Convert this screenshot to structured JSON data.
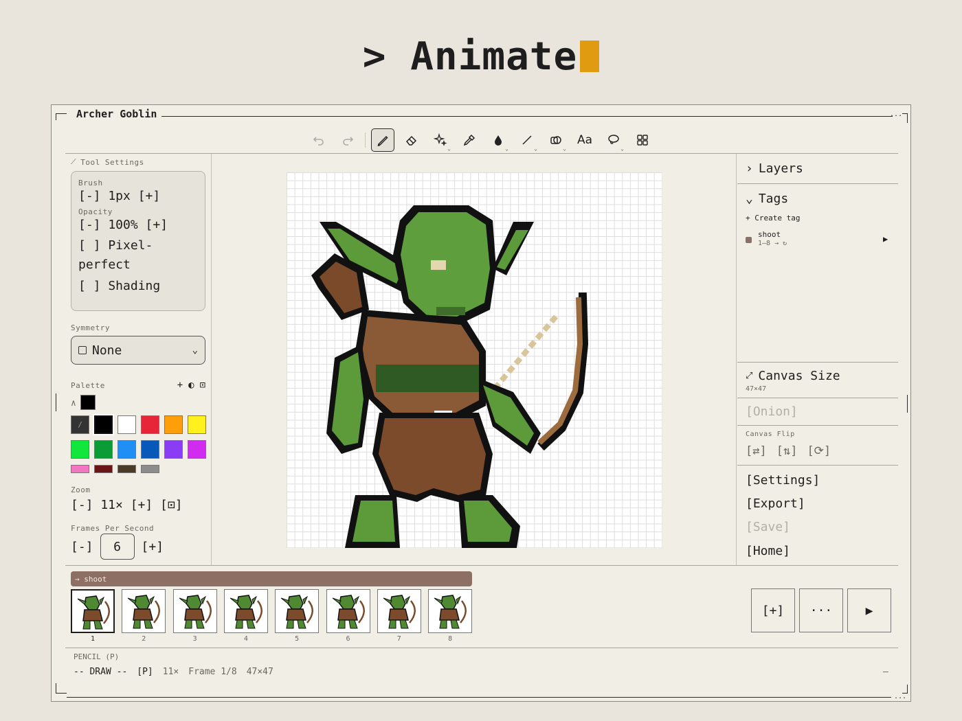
{
  "hero": {
    "prompt": ">",
    "title": "Animate"
  },
  "window": {
    "title": "Archer Goblin"
  },
  "toolbar": {
    "text_tool": "Aa"
  },
  "tool_settings": {
    "header": "Tool Settings",
    "brush_label": "Brush",
    "brush_value": "[-] 1px [+]",
    "opacity_label": "Opacity",
    "opacity_value": "[-] 100% [+]",
    "pixel_perfect": "[ ] Pixel-perfect",
    "shading": "[ ] Shading"
  },
  "symmetry": {
    "label": "Symmetry",
    "value": "None"
  },
  "palette": {
    "label": "Palette",
    "current_color": "#000000",
    "colors": [
      "#333333",
      "#000000",
      "#ffffff",
      "#e8263a",
      "#ff9e0b",
      "#fff01e",
      "#11e63c",
      "#0b9c35",
      "#1f8ff5",
      "#0758b8",
      "#8b3cf5",
      "#d02cf0",
      "#f276c2",
      "#6b1616",
      "#4a3a28",
      "#8c8c8c"
    ]
  },
  "zoom": {
    "label": "Zoom",
    "value": "[-] 11× [+] [⊡]"
  },
  "fps": {
    "label": "Frames Per Second",
    "minus": "[-]",
    "value": "6",
    "plus": "[+]"
  },
  "right_panel": {
    "layers": "Layers",
    "tags": "Tags",
    "create_tag": "+ Create tag",
    "tag_name": "shoot",
    "tag_range": "1–8 → ↻",
    "tag_color": "#8e6f63",
    "canvas_size": "Canvas Size",
    "canvas_dims": "47×47",
    "onion": "[Onion]",
    "canvas_flip_label": "Canvas Flip",
    "flip_h": "[⇄]",
    "flip_v": "[⇅]",
    "rotate": "[⟳]",
    "settings": "[Settings]",
    "export": "[Export]",
    "save": "[Save]",
    "home": "[Home]"
  },
  "timeline": {
    "tag_label": "→ shoot",
    "frames": [
      "1",
      "2",
      "3",
      "4",
      "5",
      "6",
      "7",
      "8"
    ],
    "current_frame": 1,
    "add": "[+]",
    "more": "···"
  },
  "status": {
    "tool_mode": "PENCIL (P)",
    "mode": "-- DRAW --",
    "key": "[P]",
    "zoom": "11×",
    "frame": "Frame 1/8",
    "size": "47×47",
    "end": "–"
  }
}
